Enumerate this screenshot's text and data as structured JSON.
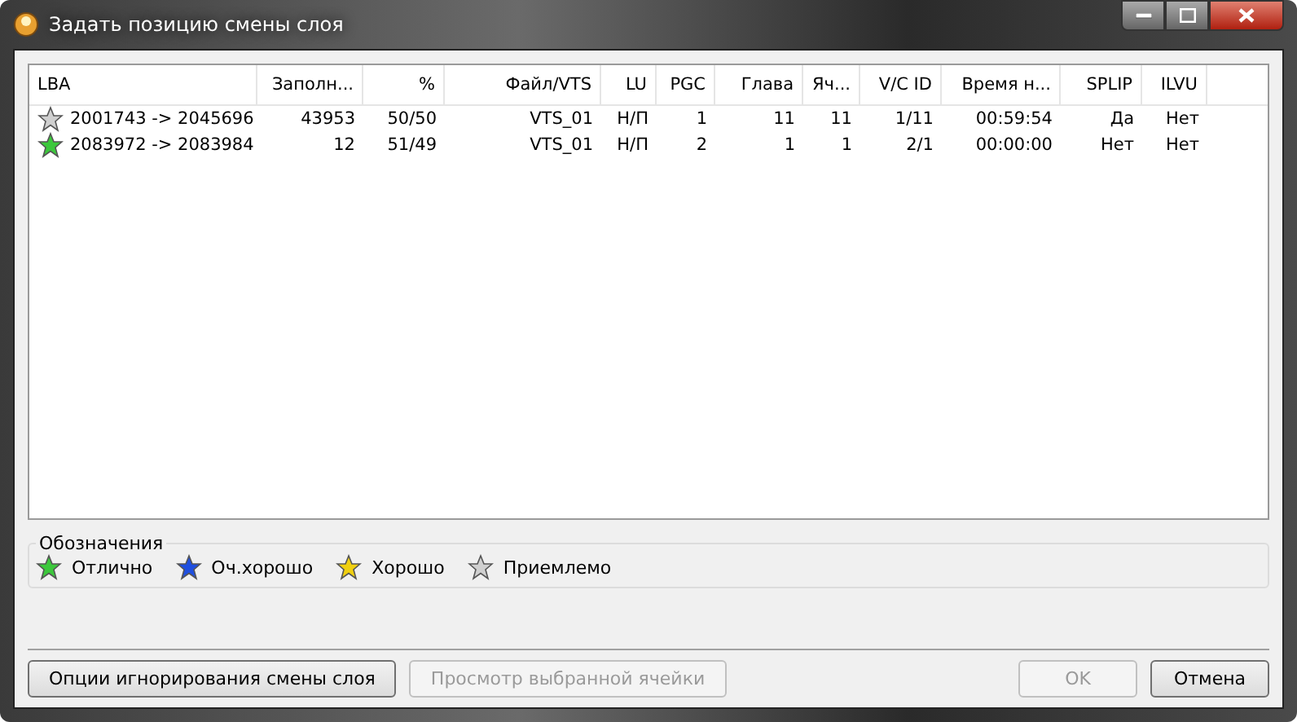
{
  "window": {
    "title": "Задать позицию смены слоя"
  },
  "table": {
    "columns": [
      "LBA",
      "Заполн...",
      "%",
      "Файл/VTS",
      "LU",
      "PGC",
      "Глава",
      "Яч...",
      "V/C ID",
      "Время н...",
      "SPLIP",
      "ILVU"
    ],
    "rows": [
      {
        "color": "#d0d0d0",
        "selected": false,
        "cells": [
          "2001743 -> 2045696",
          "43953",
          "50/50",
          "VTS_01",
          "Н/П",
          "1",
          "11",
          "11",
          "1/11",
          "00:59:54",
          "Да",
          "Нет"
        ]
      },
      {
        "color": "#3cc83c",
        "selected": false,
        "cells": [
          "2083972 -> 2083984",
          "12",
          "51/49",
          "VTS_01",
          "Н/П",
          "2",
          "1",
          "1",
          "2/1",
          "00:00:00",
          "Нет",
          "Нет"
        ]
      }
    ]
  },
  "legend": {
    "title": "Обозначения",
    "items": [
      {
        "label": "Отлично",
        "color": "#3cc83c"
      },
      {
        "label": "Оч.хорошо",
        "color": "#1f4fe0"
      },
      {
        "label": "Хорошо",
        "color": "#f0d010"
      },
      {
        "label": "Приемлемо",
        "color": "#d0d0d0"
      }
    ]
  },
  "buttons_left": [
    {
      "label": "Опции игнорирования смены слоя",
      "disabled": false
    },
    {
      "label": "Просмотр выбранной ячейки",
      "disabled": true
    }
  ],
  "buttons_right": [
    {
      "label": "OK",
      "disabled": true
    },
    {
      "label": "Отмена",
      "disabled": false
    }
  ]
}
